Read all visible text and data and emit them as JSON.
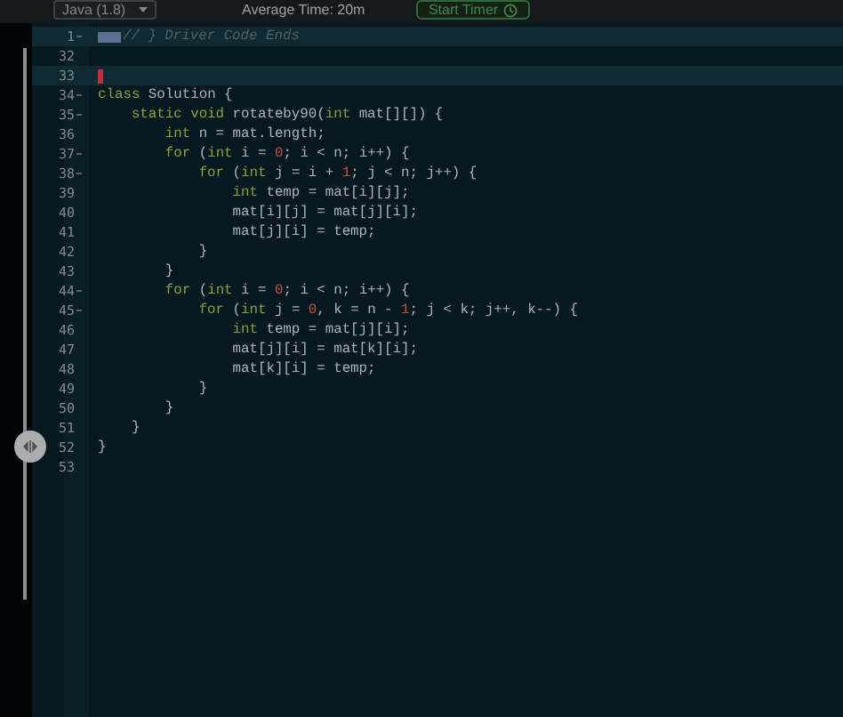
{
  "toolbar": {
    "language": "Java (1.8)",
    "average_time": "Average Time: 20m",
    "timer_button": "Start Timer"
  },
  "code_lines": [
    {
      "number": "1",
      "foldable": true,
      "highlighted": true,
      "fold_marker": true,
      "tokens": [
        {
          "kind": "comment",
          "text": "// } Driver Code Ends"
        }
      ]
    },
    {
      "number": "32"
    },
    {
      "number": "33",
      "highlighted": true,
      "cursor": true
    },
    {
      "number": "34",
      "foldable": true,
      "tokens": [
        {
          "kind": "keyword",
          "text": "class"
        },
        {
          "kind": "plain",
          "text": " Solution {"
        }
      ]
    },
    {
      "number": "35",
      "foldable": true,
      "tokens": [
        {
          "kind": "keyword",
          "text": "    static void"
        },
        {
          "kind": "plain",
          "text": " rotateby90("
        },
        {
          "kind": "keyword",
          "text": "int"
        },
        {
          "kind": "plain",
          "text": " mat[][]) {"
        }
      ]
    },
    {
      "number": "36",
      "tokens": [
        {
          "kind": "keyword",
          "text": "        int"
        },
        {
          "kind": "plain",
          "text": " n = mat.length;"
        }
      ]
    },
    {
      "number": "37",
      "foldable": true,
      "tokens": [
        {
          "kind": "keyword",
          "text": "        for"
        },
        {
          "kind": "plain",
          "text": " ("
        },
        {
          "kind": "keyword",
          "text": "int"
        },
        {
          "kind": "plain",
          "text": " i = "
        },
        {
          "kind": "number",
          "text": "0"
        },
        {
          "kind": "plain",
          "text": "; i < n; i++) {"
        }
      ]
    },
    {
      "number": "38",
      "foldable": true,
      "tokens": [
        {
          "kind": "keyword",
          "text": "            for"
        },
        {
          "kind": "plain",
          "text": " ("
        },
        {
          "kind": "keyword",
          "text": "int"
        },
        {
          "kind": "plain",
          "text": " j = i + "
        },
        {
          "kind": "number",
          "text": "1"
        },
        {
          "kind": "plain",
          "text": "; j < n; j++) {"
        }
      ]
    },
    {
      "number": "39",
      "tokens": [
        {
          "kind": "keyword",
          "text": "                int"
        },
        {
          "kind": "plain",
          "text": " temp = mat[i][j];"
        }
      ]
    },
    {
      "number": "40",
      "tokens": [
        {
          "kind": "plain",
          "text": "                mat[i][j] = mat[j][i];"
        }
      ]
    },
    {
      "number": "41",
      "tokens": [
        {
          "kind": "plain",
          "text": "                mat[j][i] = temp;"
        }
      ]
    },
    {
      "number": "42",
      "tokens": [
        {
          "kind": "plain",
          "text": "            }"
        }
      ]
    },
    {
      "number": "43",
      "tokens": [
        {
          "kind": "plain",
          "text": "        }"
        }
      ]
    },
    {
      "number": "44",
      "foldable": true,
      "tokens": [
        {
          "kind": "keyword",
          "text": "        for"
        },
        {
          "kind": "plain",
          "text": " ("
        },
        {
          "kind": "keyword",
          "text": "int"
        },
        {
          "kind": "plain",
          "text": " i = "
        },
        {
          "kind": "number",
          "text": "0"
        },
        {
          "kind": "plain",
          "text": "; i < n; i++) {"
        }
      ]
    },
    {
      "number": "45",
      "foldable": true,
      "tokens": [
        {
          "kind": "keyword",
          "text": "            for"
        },
        {
          "kind": "plain",
          "text": " ("
        },
        {
          "kind": "keyword",
          "text": "int"
        },
        {
          "kind": "plain",
          "text": " j = "
        },
        {
          "kind": "number",
          "text": "0"
        },
        {
          "kind": "plain",
          "text": ", k = n - "
        },
        {
          "kind": "number",
          "text": "1"
        },
        {
          "kind": "plain",
          "text": "; j < k; j++, k--) {"
        }
      ]
    },
    {
      "number": "46",
      "tokens": [
        {
          "kind": "keyword",
          "text": "                int"
        },
        {
          "kind": "plain",
          "text": " temp = mat[j][i];"
        }
      ]
    },
    {
      "number": "47",
      "tokens": [
        {
          "kind": "plain",
          "text": "                mat[j][i] = mat[k][i];"
        }
      ]
    },
    {
      "number": "48",
      "tokens": [
        {
          "kind": "plain",
          "text": "                mat[k][i] = temp;"
        }
      ]
    },
    {
      "number": "49",
      "tokens": [
        {
          "kind": "plain",
          "text": "            }"
        }
      ]
    },
    {
      "number": "50",
      "tokens": [
        {
          "kind": "plain",
          "text": "        }"
        }
      ]
    },
    {
      "number": "51",
      "tokens": [
        {
          "kind": "plain",
          "text": "    }"
        }
      ]
    },
    {
      "number": "52",
      "tokens": [
        {
          "kind": "plain",
          "text": "}"
        }
      ]
    },
    {
      "number": "53"
    }
  ]
}
